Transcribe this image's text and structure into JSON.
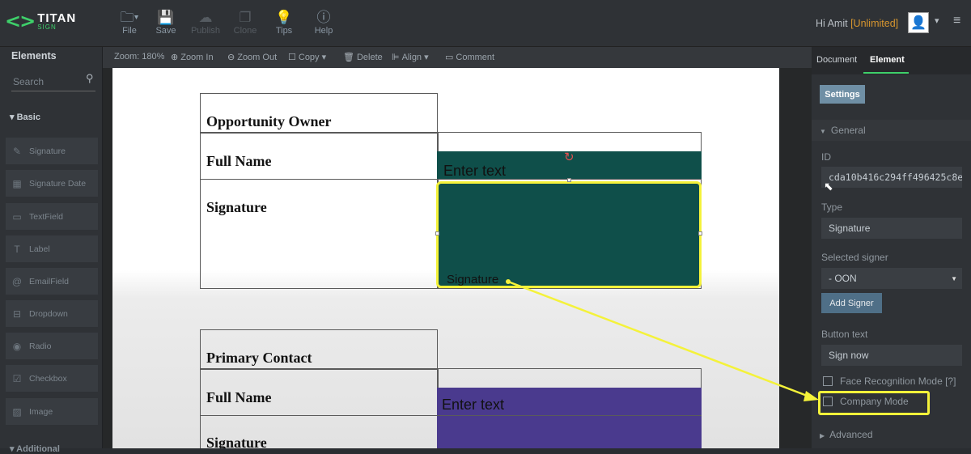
{
  "app": {
    "logo_title": "TITAN",
    "logo_sub": "SIGN"
  },
  "toolbar": {
    "file": "File",
    "save": "Save",
    "publish": "Publish",
    "clone": "Clone",
    "tips": "Tips",
    "help": "Help"
  },
  "user": {
    "greeting": "Hi Amit",
    "plan": "[Unlimited]"
  },
  "elements_panel": {
    "title": "Elements",
    "search_placeholder": "Search",
    "basic_label": "Basic",
    "items": [
      {
        "label": "Signature",
        "icon": "pen-icon"
      },
      {
        "label": "Signature Date",
        "icon": "calendar-icon"
      },
      {
        "label": "TextField",
        "icon": "textfield-icon"
      },
      {
        "label": "Label",
        "icon": "label-icon"
      },
      {
        "label": "EmailField",
        "icon": "at-icon"
      },
      {
        "label": "Dropdown",
        "icon": "dropdown-icon"
      },
      {
        "label": "Radio",
        "icon": "radio-icon"
      },
      {
        "label": "Checkbox",
        "icon": "checkbox-icon"
      },
      {
        "label": "Image",
        "icon": "image-icon"
      }
    ],
    "additional_label": "Additional"
  },
  "subbar": {
    "zoom": "Zoom: 180%",
    "zoom_in": "Zoom In",
    "zoom_out": "Zoom Out",
    "copy": "Copy",
    "delete": "Delete",
    "align": "Align",
    "comment": "Comment"
  },
  "document": {
    "section1": {
      "header": "Opportunity Owner",
      "full_name": "Full Name",
      "signature": "Signature",
      "enter_text": "Enter text",
      "sig_field": "Signature"
    },
    "section2": {
      "header": "Primary Contact",
      "full_name": "Full Name",
      "signature": "Signature",
      "enter_text": "Enter text"
    }
  },
  "right_panel": {
    "tabs": [
      "Document",
      "Element"
    ],
    "settings": "Settings",
    "general": "General",
    "id_label": "ID",
    "id_value": "cda10b416c294ff496425c8e",
    "type_label": "Type",
    "type_value": "Signature",
    "signer_label": "Selected signer",
    "signer_value": "- OON",
    "add_signer": "Add Signer",
    "button_text_label": "Button text",
    "button_text_value": "Sign now",
    "face_recognition": "Face Recognition Mode [?]",
    "company_mode": "Company Mode",
    "advanced": "Advanced"
  },
  "colors": {
    "accent": "#3ecf6a",
    "teal": "#0f4f4a",
    "purple": "#4a3a8e",
    "highlight": "#f4f23a"
  }
}
